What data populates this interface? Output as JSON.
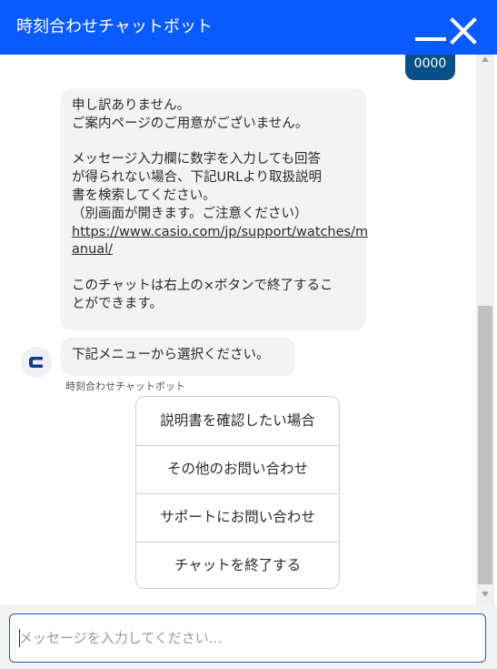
{
  "header": {
    "title": "時刻合わせチャットボット",
    "background_color": "#0a5bff",
    "minimize_icon": "minimize-icon",
    "close_icon": "close-icon"
  },
  "messages": {
    "user": {
      "text": "0000",
      "color": "#0a4f86"
    },
    "bot_1": {
      "lines": [
        "申し訳ありません。",
        "ご案内ページのご用意がございません。",
        "",
        "メッセージ入力欄に数字を入力しても回答",
        "が得られない場合、下記URLより取扱説明",
        "書を検索してください。",
        "（別画面が開きます。ご注意ください）"
      ],
      "link_line_1": "https://www.casio.com/jp/support/watches/m",
      "link_line_2": "anual/",
      "end_lines": [
        "このチャットは右上の×ボタンで終了するこ",
        "とができます。"
      ]
    },
    "bot_2": {
      "text": "下記メニューから選択ください。"
    },
    "bot_name": "時刻合わせチャットボット",
    "avatar_icon": "casio-c-logo-icon",
    "bubble_color": "#f3f3f3"
  },
  "menu": {
    "items": [
      "説明書を確認したい場合",
      "その他のお問い合わせ",
      "サポートにお問い合わせ",
      "チャットを終了する"
    ]
  },
  "input": {
    "placeholder": "メッセージを入力してください..."
  }
}
